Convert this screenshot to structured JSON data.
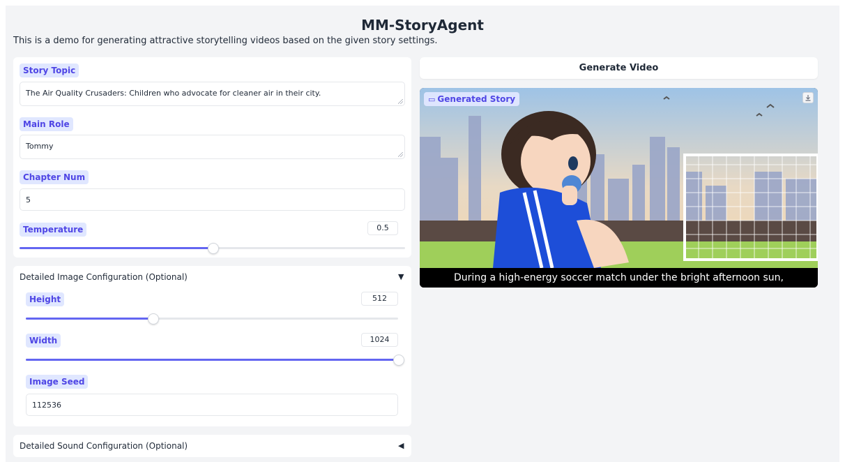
{
  "app": {
    "title": "MM-StoryAgent",
    "subtitle": "This is a demo for generating attractive storytelling videos based on the given story settings."
  },
  "story_settings": {
    "topic": {
      "label": "Story Topic",
      "value": "The Air Quality Crusaders: Children who advocate for cleaner air in their city."
    },
    "main_role": {
      "label": "Main Role",
      "value": "Tommy"
    },
    "chapter_num": {
      "label": "Chapter Num",
      "value": "5"
    },
    "temperature": {
      "label": "Temperature",
      "value": "0.5",
      "fraction": 0.5
    }
  },
  "image_config": {
    "title": "Detailed Image Configuration (Optional)",
    "arrow": "▼",
    "height": {
      "label": "Height",
      "value": "512",
      "fraction": 0.34
    },
    "width": {
      "label": "Width",
      "value": "1024",
      "fraction": 1.0
    },
    "image_seed": {
      "label": "Image Seed",
      "value": "112536"
    }
  },
  "sound_config": {
    "title": "Detailed Sound Configuration (Optional)",
    "arrow": "◀"
  },
  "output": {
    "generate_button": "Generate Video",
    "video_label": "Generated Story",
    "caption": "During a high-energy soccer match under the bright afternoon sun,"
  },
  "colors": {
    "accent": "#6366f1",
    "label_bg": "#e0e7ff",
    "label_text": "#4f46e5"
  }
}
